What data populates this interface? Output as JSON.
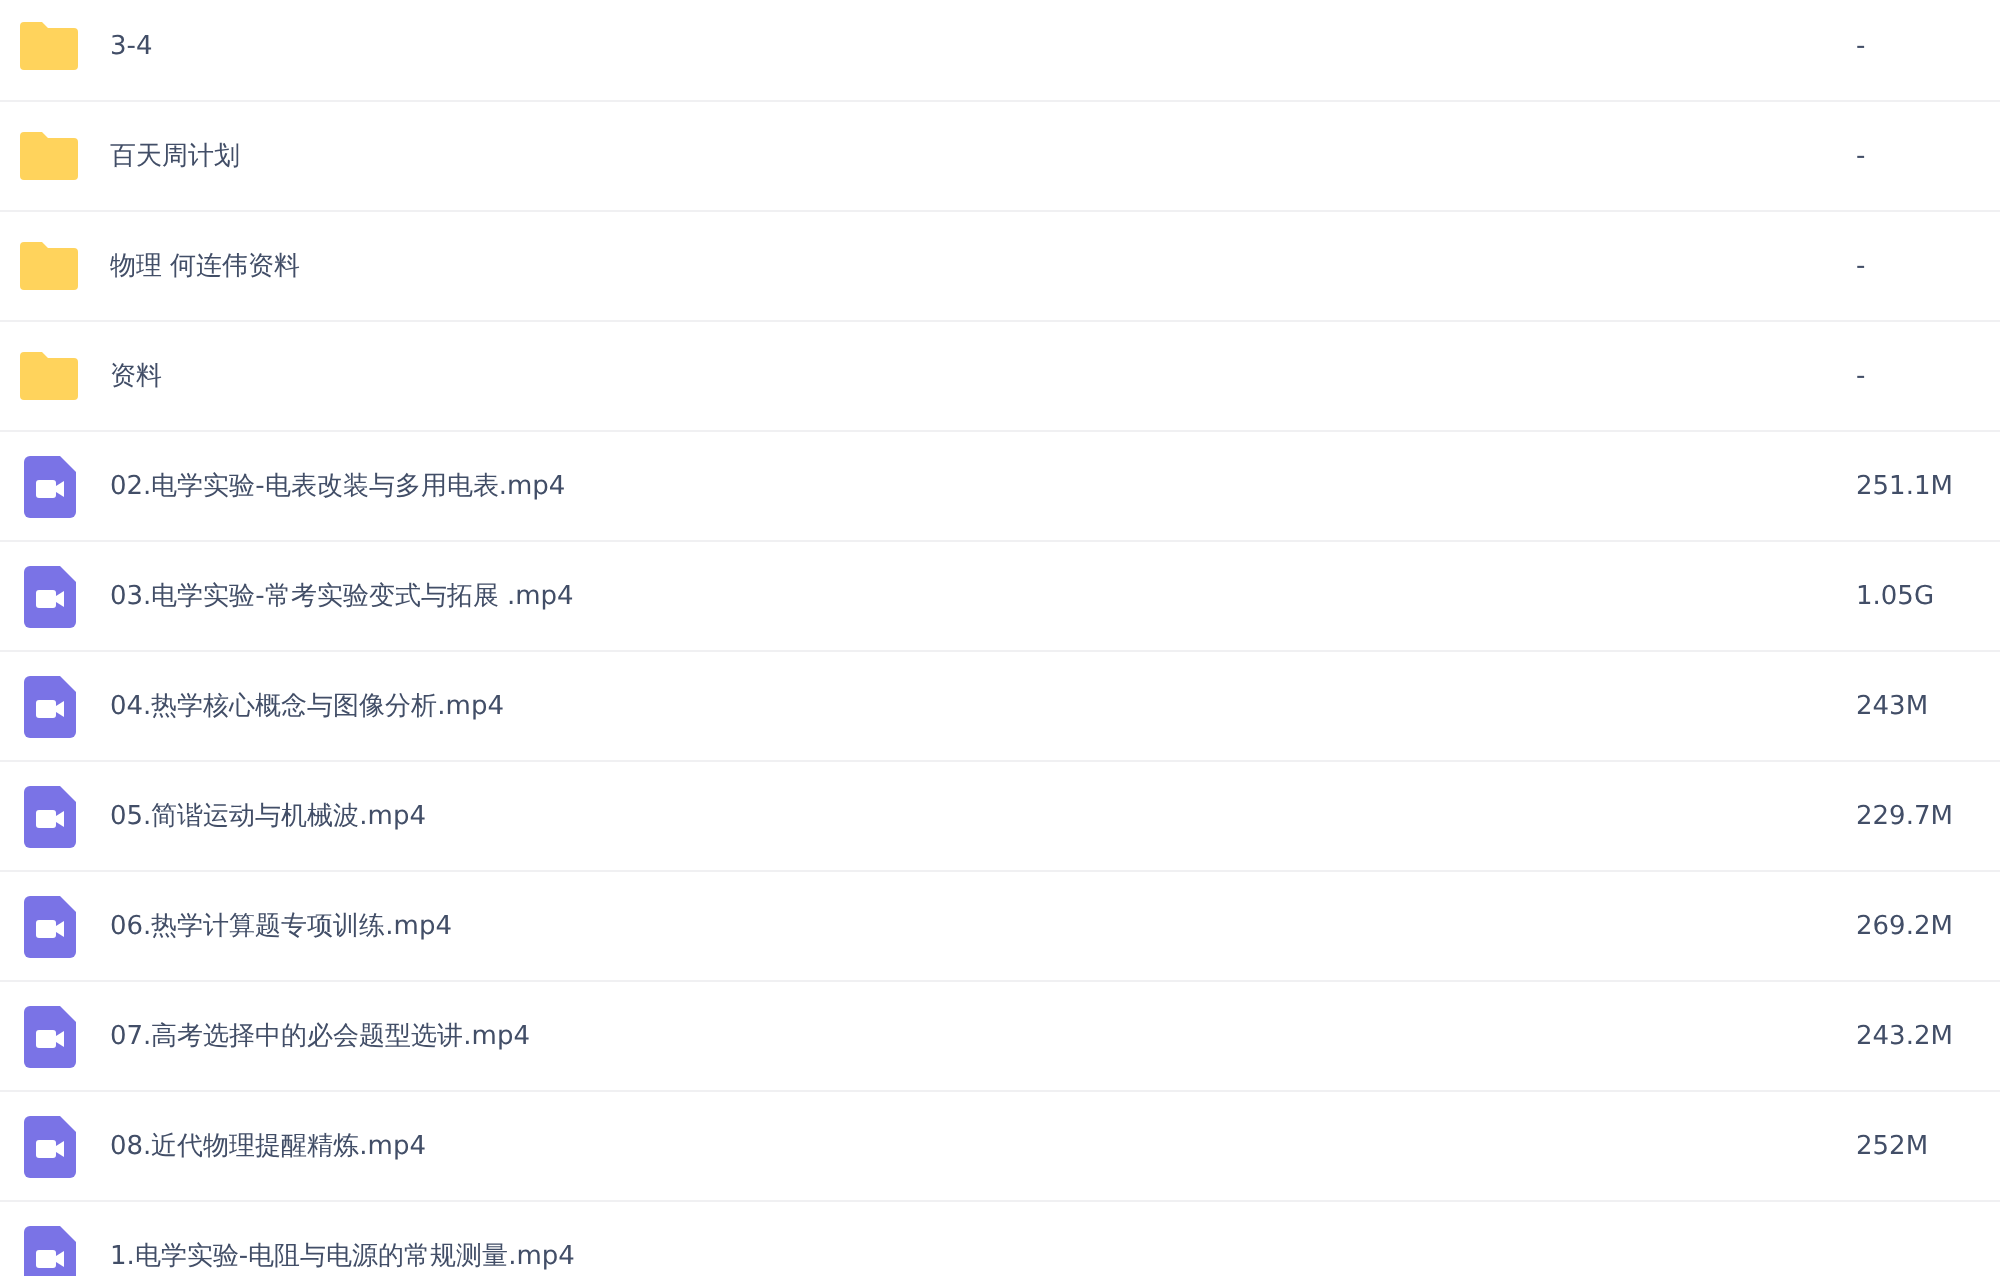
{
  "files": [
    {
      "kind": "folder",
      "name": "3-4",
      "size": "-"
    },
    {
      "kind": "folder",
      "name": "百天周计划",
      "size": "-"
    },
    {
      "kind": "folder",
      "name": "物理 何连伟资料",
      "size": "-"
    },
    {
      "kind": "folder",
      "name": "资料",
      "size": "-"
    },
    {
      "kind": "video",
      "name": "02.电学实验-电表改装与多用电表.mp4",
      "size": "251.1M"
    },
    {
      "kind": "video",
      "name": "03.电学实验-常考实验变式与拓展 .mp4",
      "size": "1.05G"
    },
    {
      "kind": "video",
      "name": "04.热学核心概念与图像分析.mp4",
      "size": "243M"
    },
    {
      "kind": "video",
      "name": "05.简谐运动与机械波.mp4",
      "size": "229.7M"
    },
    {
      "kind": "video",
      "name": "06.热学计算题专项训练.mp4",
      "size": "269.2M"
    },
    {
      "kind": "video",
      "name": "07.高考选择中的必会题型选讲.mp4",
      "size": "243.2M"
    },
    {
      "kind": "video",
      "name": "08.近代物理提醒精炼.mp4",
      "size": "252M"
    },
    {
      "kind": "video",
      "name": "1.电学实验-电阻与电源的常规测量.mp4"
    }
  ]
}
